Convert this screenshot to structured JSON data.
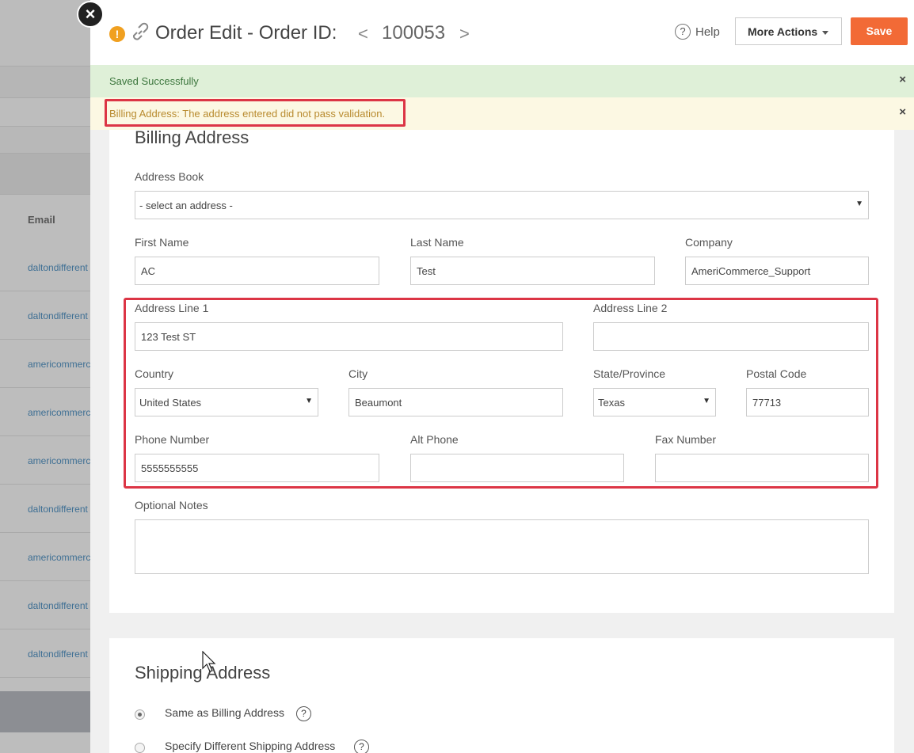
{
  "background": {
    "email_header": "Email",
    "rows": [
      "daltondifferent",
      "daltondifferent",
      "americommerc",
      "americommerc",
      "americommerc",
      "daltondifferent",
      "americommerc",
      "daltondifferent",
      "daltondifferent"
    ]
  },
  "header": {
    "title": "Order Edit - Order ID:",
    "prev": "<",
    "order_id": "100053",
    "next": ">",
    "help_label": "Help",
    "help_icon": "?",
    "more_actions_label": "More Actions",
    "save_label": "Save"
  },
  "alerts": {
    "success": "Saved Successfully",
    "warning": "Billing Address: The address entered did not pass validation.",
    "close": "×"
  },
  "billing": {
    "title": "Billing Address",
    "address_book": {
      "label": "Address Book",
      "value": "- select an address -"
    },
    "first_name": {
      "label": "First Name",
      "value": "AC"
    },
    "last_name": {
      "label": "Last Name",
      "value": "Test"
    },
    "company": {
      "label": "Company",
      "value": "AmeriCommerce_Support"
    },
    "address1": {
      "label": "Address Line 1",
      "value": "123 Test ST"
    },
    "address2": {
      "label": "Address Line 2",
      "value": ""
    },
    "country": {
      "label": "Country",
      "value": "United States"
    },
    "city": {
      "label": "City",
      "value": "Beaumont"
    },
    "state": {
      "label": "State/Province",
      "value": "Texas"
    },
    "postal": {
      "label": "Postal Code",
      "value": "77713"
    },
    "phone": {
      "label": "Phone Number",
      "value": "5555555555"
    },
    "alt_phone": {
      "label": "Alt Phone",
      "value": ""
    },
    "fax": {
      "label": "Fax Number",
      "value": ""
    },
    "notes": {
      "label": "Optional Notes",
      "value": ""
    }
  },
  "shipping": {
    "title": "Shipping Address",
    "same_label": "Same as Billing Address",
    "different_label": "Specify Different Shipping Address",
    "help_icon": "?"
  },
  "colors": {
    "save": "#f26a36",
    "highlight": "#dc3545",
    "success_bg": "#dff0d8",
    "warning_bg": "#fcf8e3"
  }
}
